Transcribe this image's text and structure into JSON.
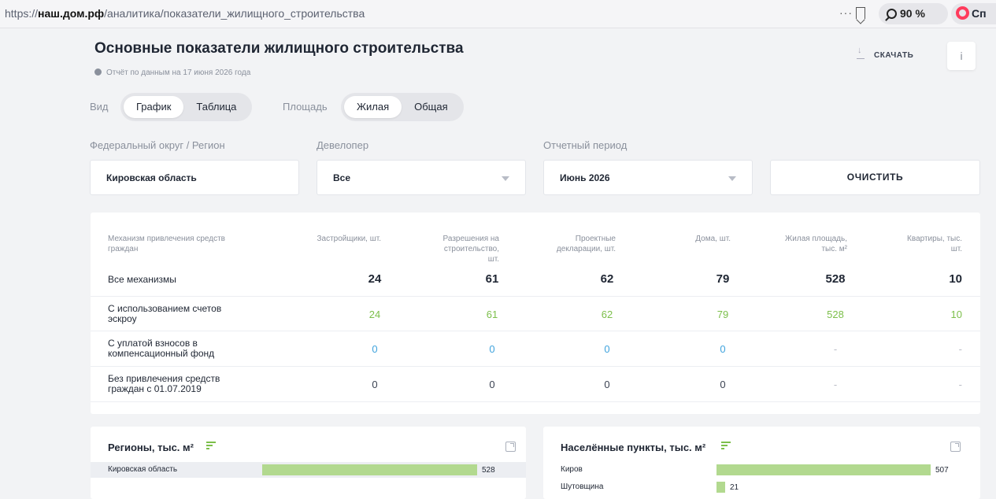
{
  "browser": {
    "url_prefix": "https://",
    "url_host": "наш.дом.рф",
    "url_path": "/аналитика/показатели_жилищного_строительства",
    "menu_dots": "···",
    "zoom": "90 %",
    "ext_label": "Сп"
  },
  "header": {
    "title": "Основные показатели жилищного строительства",
    "report_date": "Отчёт по данным на 17 июня 2026 года",
    "download_label": "СКАЧАТЬ",
    "info_label": "i"
  },
  "view_toggle": {
    "label": "Вид",
    "options": [
      "График",
      "Таблица"
    ],
    "active": "График"
  },
  "area_toggle": {
    "label": "Площадь",
    "options": [
      "Жилая",
      "Общая"
    ],
    "active": "Жилая"
  },
  "filters": {
    "region": {
      "label": "Федеральный округ / Регион",
      "value": "Кировская область"
    },
    "developer": {
      "label": "Девелопер",
      "value": "Все"
    },
    "period": {
      "label": "Отчетный период",
      "value": "Июнь 2026"
    },
    "clear_label": "ОЧИСТИТЬ"
  },
  "table": {
    "headers": [
      "Механизм привлечения средств граждан",
      "Застройщики, шт.",
      "Разрешения на строительство, шт.",
      "Проектные декларации, шт.",
      "Дома, шт.",
      "Жилая площадь, тыс. м²",
      "Квартиры, тыс. шт."
    ],
    "rows": [
      {
        "label": "Все механизмы",
        "values": [
          "24",
          "61",
          "62",
          "79",
          "528",
          "10"
        ]
      },
      {
        "label": "С использованием счетов эскроу",
        "values": [
          "24",
          "61",
          "62",
          "79",
          "528",
          "10"
        ]
      },
      {
        "label": "С уплатой взносов в компенсационный фонд",
        "values": [
          "0",
          "0",
          "0",
          "0",
          "-",
          "-"
        ]
      },
      {
        "label": "Без привлечения средств граждан с 01.07.2019",
        "values": [
          "0",
          "0",
          "0",
          "0",
          "-",
          "-"
        ]
      }
    ]
  },
  "regions_panel": {
    "title": "Регионы, тыс. м²",
    "items": [
      {
        "label": "Кировская область",
        "value": 528
      }
    ]
  },
  "settlements_panel": {
    "title": "Населённые пункты, тыс. м²",
    "items": [
      {
        "label": "Киров",
        "value": 507
      },
      {
        "label": "Шутовщина",
        "value": 21
      }
    ]
  },
  "colors": {
    "accent_green": "#7cbf4a",
    "bar_green": "#b2d98f",
    "blue": "#3fa3dd"
  }
}
